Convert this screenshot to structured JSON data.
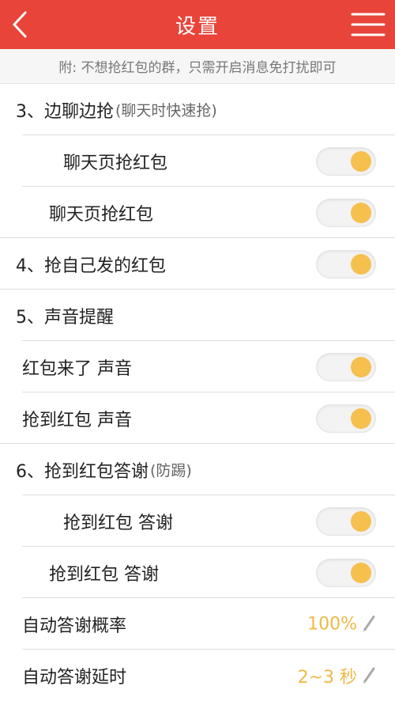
{
  "header": {
    "title": "设置"
  },
  "notice": "附: 不想抢红包的群，只需开启消息免打扰即可",
  "colors": {
    "accent": "#e8443a",
    "toggle_on": "#f6c04f",
    "value_text": "#f0b945"
  },
  "rows": [
    {
      "label": "3、边聊边抢",
      "hint": "(聊天时快速抢)"
    },
    {
      "label": "聊天页抢红包",
      "toggle": true
    },
    {
      "label": "聊天页抢红包",
      "toggle": true
    },
    {
      "label": "4、抢自己发的红包",
      "toggle": true
    },
    {
      "label": "5、声音提醒"
    },
    {
      "label": "红包来了 声音",
      "toggle": true
    },
    {
      "label": "抢到红包 声音",
      "toggle": true
    },
    {
      "label": "6、抢到红包答谢",
      "hint": "(防踢)"
    },
    {
      "label": "抢到红包 答谢",
      "toggle": true
    },
    {
      "label": "抢到红包 答谢",
      "toggle": true
    },
    {
      "label": "自动答谢概率",
      "value": "100%"
    },
    {
      "label": "自动答谢延时",
      "value": "2~3 秒"
    }
  ],
  "icons": {
    "back": "chevron-left-icon",
    "menu": "hamburger-menu-icon",
    "edit": "pencil-icon"
  }
}
